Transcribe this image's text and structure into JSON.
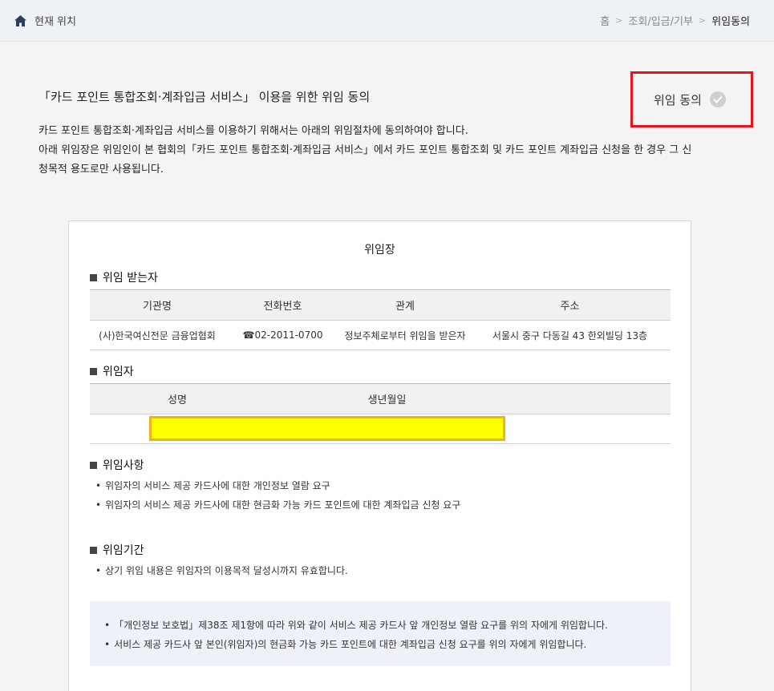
{
  "header": {
    "location_label": "현재 위치",
    "breadcrumb": [
      "홈",
      "조회/입금/기부",
      "위임동의"
    ],
    "sep": ">"
  },
  "page": {
    "title": "「카드 포인트 통합조회·계좌입금 서비스」 이용을 위한 위임 동의",
    "intro_lines": [
      "카드 포인트 통합조회·계좌입금 서비스를 이용하기 위해서는 아래의 위임절차에 동의하여야 합니다.",
      "아래 위임장은 위임인이 본 협회의「카드 포인트 통합조회·계좌입금 서비스」에서 카드 포인트 통합조회 및 카드 포인트 계좌입금 신청을 한 경우 그 신",
      "청목적 용도로만 사용됩니다."
    ],
    "consent_label": "위임 동의"
  },
  "card": {
    "title": "위임장",
    "delegatee": {
      "heading": "위임 받는자",
      "columns": [
        "기관명",
        "전화번호",
        "관계",
        "주소"
      ],
      "row": [
        "(사)한국여신전문 금융업협회",
        "☎02-2011-0700",
        "정보주체로부터 위임을 받은자",
        "서울시 중구 다동길 43 한외빌딩 13층"
      ]
    },
    "delegator": {
      "heading": "위임자",
      "columns": [
        "성명",
        "생년월일"
      ]
    },
    "matters": {
      "heading": "위임사항",
      "items": [
        "위임자의 서비스 제공 카드사에 대한 개인정보 열람 요구",
        "위임자의 서비스 제공 카드사에 대한 현금화 가능 카드 포인트에 대한 계좌입금 신청 요구"
      ]
    },
    "period": {
      "heading": "위임기간",
      "items": [
        "상기 위임 내용은 위임자의 이용목적 달성시까지 유효합니다."
      ]
    },
    "notice": [
      "「개인정보 보호법」제38조 제1항에 따라 위와 같이 서비스 제공 카드사 앞 개인정보 열람 요구를 위의 자에게 위임합니다.",
      "서비스 제공 카드사 앞 본인(위임자)의 현금화 가능 카드 포인트에 대한 계좌입금 신청 요구를 위의 자에게 위임합니다."
    ]
  },
  "colors": {
    "highlight_border": "#e8141a",
    "redaction_fill": "#ffff00",
    "redaction_border": "#f1b11a"
  }
}
